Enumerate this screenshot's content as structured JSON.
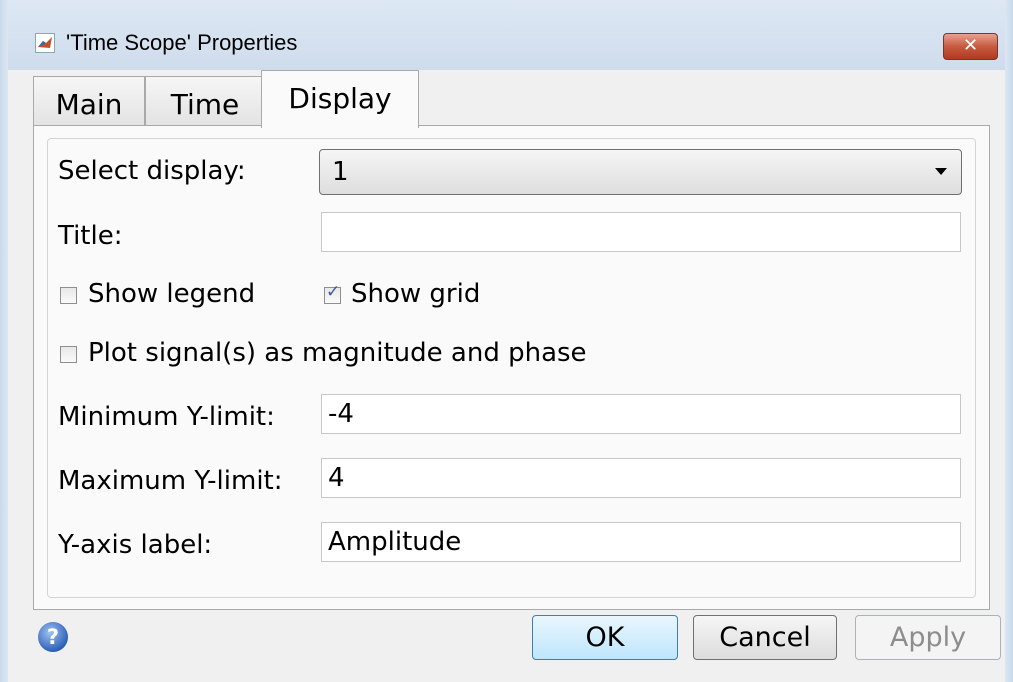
{
  "window": {
    "title": "'Time Scope' Properties",
    "close_icon": "close-icon",
    "app_icon": "matlab-icon"
  },
  "tabs": [
    {
      "label": "Main",
      "active": false
    },
    {
      "label": "Time",
      "active": false
    },
    {
      "label": "Display",
      "active": true
    }
  ],
  "display": {
    "select_display_label": "Select display:",
    "select_display_value": "1",
    "title_label": "Title:",
    "title_value": "",
    "show_legend_label": "Show legend",
    "show_legend_checked": false,
    "show_grid_label": "Show grid",
    "show_grid_checked": true,
    "mag_phase_label": "Plot signal(s) as magnitude and phase",
    "mag_phase_checked": false,
    "min_y_label": "Minimum Y-limit:",
    "min_y_value": "-4",
    "max_y_label": "Maximum Y-limit:",
    "max_y_value": "4",
    "y_axis_label": "Y-axis label:",
    "y_axis_value": "Amplitude"
  },
  "buttons": {
    "ok": "OK",
    "cancel": "Cancel",
    "apply": "Apply",
    "help_icon": "help-icon"
  },
  "colors": {
    "default_button": "#bee6fd",
    "close_button": "#c75a40"
  }
}
